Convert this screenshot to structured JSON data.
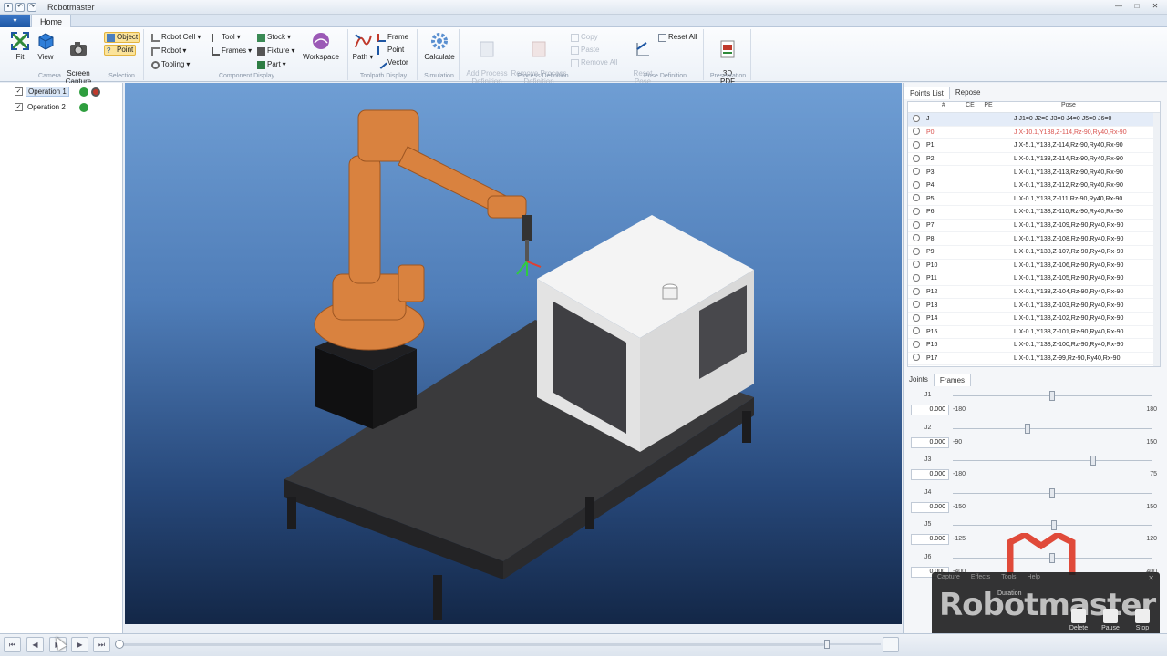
{
  "window": {
    "title": "Robotmaster",
    "quick_access": [
      "save-icon",
      "undo-icon",
      "redo-icon"
    ],
    "controls": [
      "minimize-icon",
      "maximize-icon",
      "close-icon"
    ]
  },
  "tabs": {
    "app_menu": "",
    "home": "Home"
  },
  "ribbon": {
    "camera": {
      "label": "Camera",
      "fit": "Fit",
      "view": "View",
      "screen_capture": "Screen\nCapture"
    },
    "selection": {
      "label": "Selection",
      "object": "Object",
      "point": "Point"
    },
    "component_display": {
      "label": "Component Display",
      "robot_cell": "Robot Cell",
      "robot": "Robot",
      "tooling": "Tooling",
      "tool": "Tool",
      "frames": "Frames",
      "stock": "Stock",
      "fixture": "Fixture",
      "part": "Part",
      "workspace": "Workspace"
    },
    "toolpath_display": {
      "label": "Toolpath Display",
      "path": "Path",
      "frame": "Frame",
      "point": "Point",
      "vector": "Vector"
    },
    "simulation": {
      "label": "Simulation",
      "calculate": "Calculate"
    },
    "process_definition": {
      "label": "Process Definition",
      "add": "Add Process\nDefinition",
      "remove": "Remove Process\nDefinition",
      "copy": "Copy",
      "paste": "Paste",
      "remove_all": "Remove All"
    },
    "pose_definition": {
      "label": "Pose Definition",
      "reset_pose": "Reset\nPose",
      "reset_all": "Reset All"
    },
    "presentation": {
      "label": "Presentation",
      "pdf": "3D\nPDF"
    }
  },
  "operations": [
    {
      "label": "Operation 1",
      "checked": "✓"
    },
    {
      "label": "Operation 2",
      "checked": "✓"
    }
  ],
  "points_panel": {
    "tabs": [
      "Points List",
      "Repose"
    ],
    "columns": [
      "#",
      "CE",
      "PE",
      "Pose"
    ],
    "rows": [
      {
        "name": "J",
        "pose": "J J1=0 J2=0 J3=0 J4=0 J5=0 J6=0"
      },
      {
        "name": "P0",
        "pose": "J X-10.1,Y138,Z-114,Rz-90,Ry40,Rx-90"
      },
      {
        "name": "P1",
        "pose": "J X-5.1,Y138,Z-114,Rz-90,Ry40,Rx-90"
      },
      {
        "name": "P2",
        "pose": "L X-0.1,Y138,Z-114,Rz-90,Ry40,Rx-90"
      },
      {
        "name": "P3",
        "pose": "L X-0.1,Y138,Z-113,Rz-90,Ry40,Rx-90"
      },
      {
        "name": "P4",
        "pose": "L X-0.1,Y138,Z-112,Rz-90,Ry40,Rx-90"
      },
      {
        "name": "P5",
        "pose": "L X-0.1,Y138,Z-111,Rz-90,Ry40,Rx-90"
      },
      {
        "name": "P6",
        "pose": "L X-0.1,Y138,Z-110,Rz-90,Ry40,Rx-90"
      },
      {
        "name": "P7",
        "pose": "L X-0.1,Y138,Z-109,Rz-90,Ry40,Rx-90"
      },
      {
        "name": "P8",
        "pose": "L X-0.1,Y138,Z-108,Rz-90,Ry40,Rx-90"
      },
      {
        "name": "P9",
        "pose": "L X-0.1,Y138,Z-107,Rz-90,Ry40,Rx-90"
      },
      {
        "name": "P10",
        "pose": "L X-0.1,Y138,Z-106,Rz-90,Ry40,Rx-90"
      },
      {
        "name": "P11",
        "pose": "L X-0.1,Y138,Z-105,Rz-90,Ry40,Rx-90"
      },
      {
        "name": "P12",
        "pose": "L X-0.1,Y138,Z-104,Rz-90,Ry40,Rx-90"
      },
      {
        "name": "P13",
        "pose": "L X-0.1,Y138,Z-103,Rz-90,Ry40,Rx-90"
      },
      {
        "name": "P14",
        "pose": "L X-0.1,Y138,Z-102,Rz-90,Ry40,Rx-90"
      },
      {
        "name": "P15",
        "pose": "L X-0.1,Y138,Z-101,Rz-90,Ry40,Rx-90"
      },
      {
        "name": "P16",
        "pose": "L X-0.1,Y138,Z-100,Rz-90,Ry40,Rx-90"
      },
      {
        "name": "P17",
        "pose": "L X-0.1,Y138,Z-99,Rz-90,Ry40,Rx-90"
      }
    ]
  },
  "joints_panel": {
    "tabs": [
      "Joints",
      "Frames"
    ],
    "joints": [
      {
        "name": "J1",
        "value": "0.000",
        "min": "-180",
        "max": "180",
        "level": 0.5
      },
      {
        "name": "J2",
        "value": "0.000",
        "min": "-90",
        "max": "150",
        "level": 0.375
      },
      {
        "name": "J3",
        "value": "0.000",
        "min": "-180",
        "max": "75",
        "level": 0.706
      },
      {
        "name": "J4",
        "value": "0.000",
        "min": "-150",
        "max": "150",
        "level": 0.5
      },
      {
        "name": "J5",
        "value": "0.000",
        "min": "-125",
        "max": "120",
        "level": 0.51
      },
      {
        "name": "J6",
        "value": "0.000",
        "min": "-400",
        "max": "400",
        "level": 0.5
      }
    ]
  },
  "recorder": {
    "menu": [
      "Capture",
      "Effects",
      "Tools",
      "Help"
    ],
    "brand": "Robotmaster",
    "tag": "Duration",
    "buttons": [
      "Delete",
      "Pause",
      "Stop"
    ]
  },
  "playback": {
    "position": 0.0
  },
  "colors": {
    "accent": "#1d56a3",
    "robot": "#d9823f",
    "viewport_top": "#6f9ed4",
    "viewport_bottom": "#132747",
    "ok": "#2e9e3e",
    "error": "#c0392b"
  }
}
